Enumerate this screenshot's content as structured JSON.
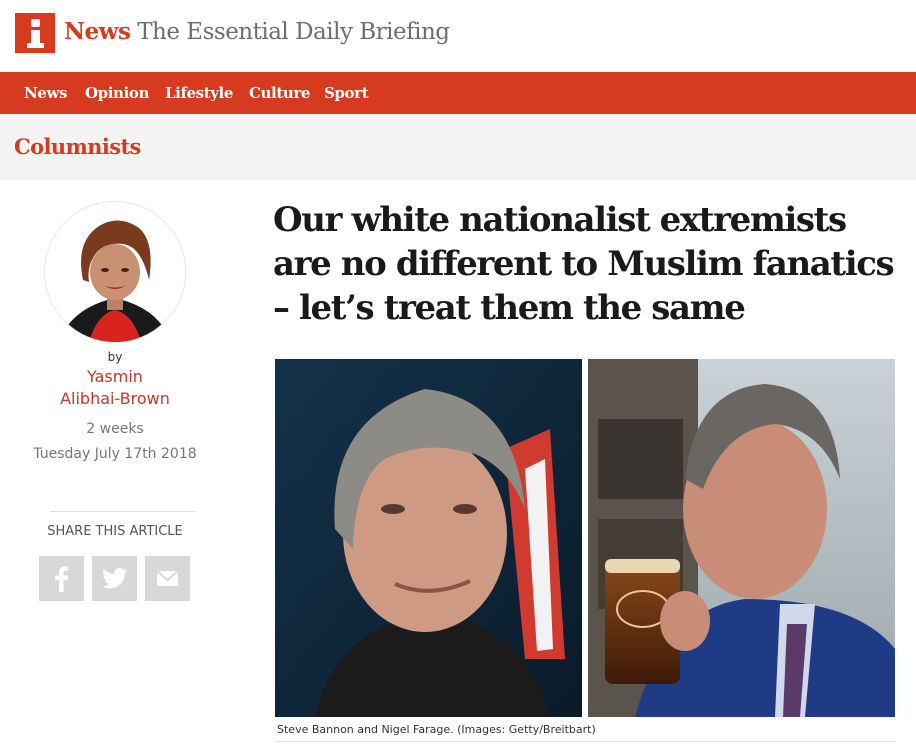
{
  "site": {
    "logo_letter": "i",
    "brand_primary": "News",
    "brand_tagline": "The Essential Daily Briefing",
    "accent_color": "#d63a1f"
  },
  "nav": {
    "items": [
      {
        "label": "News"
      },
      {
        "label": "Opinion"
      },
      {
        "label": "Lifestyle"
      },
      {
        "label": "Culture"
      },
      {
        "label": "Sport"
      }
    ]
  },
  "section": {
    "title": "Columnists"
  },
  "byline": {
    "by_label": "by",
    "author": "Yasmin Alibhai-Brown",
    "age": "2 weeks",
    "date": "Tuesday July 17th 2018"
  },
  "share": {
    "label": "SHARE THIS ARTICLE",
    "buttons": [
      {
        "icon": "facebook-icon"
      },
      {
        "icon": "twitter-icon"
      },
      {
        "icon": "email-icon"
      }
    ]
  },
  "article": {
    "headline": "Our white nationalist extremists are no different to Muslim fanatics – let’s treat them the same",
    "caption": "Steve Bannon and Nigel Farage. (Images: Getty/Breitbart)"
  }
}
